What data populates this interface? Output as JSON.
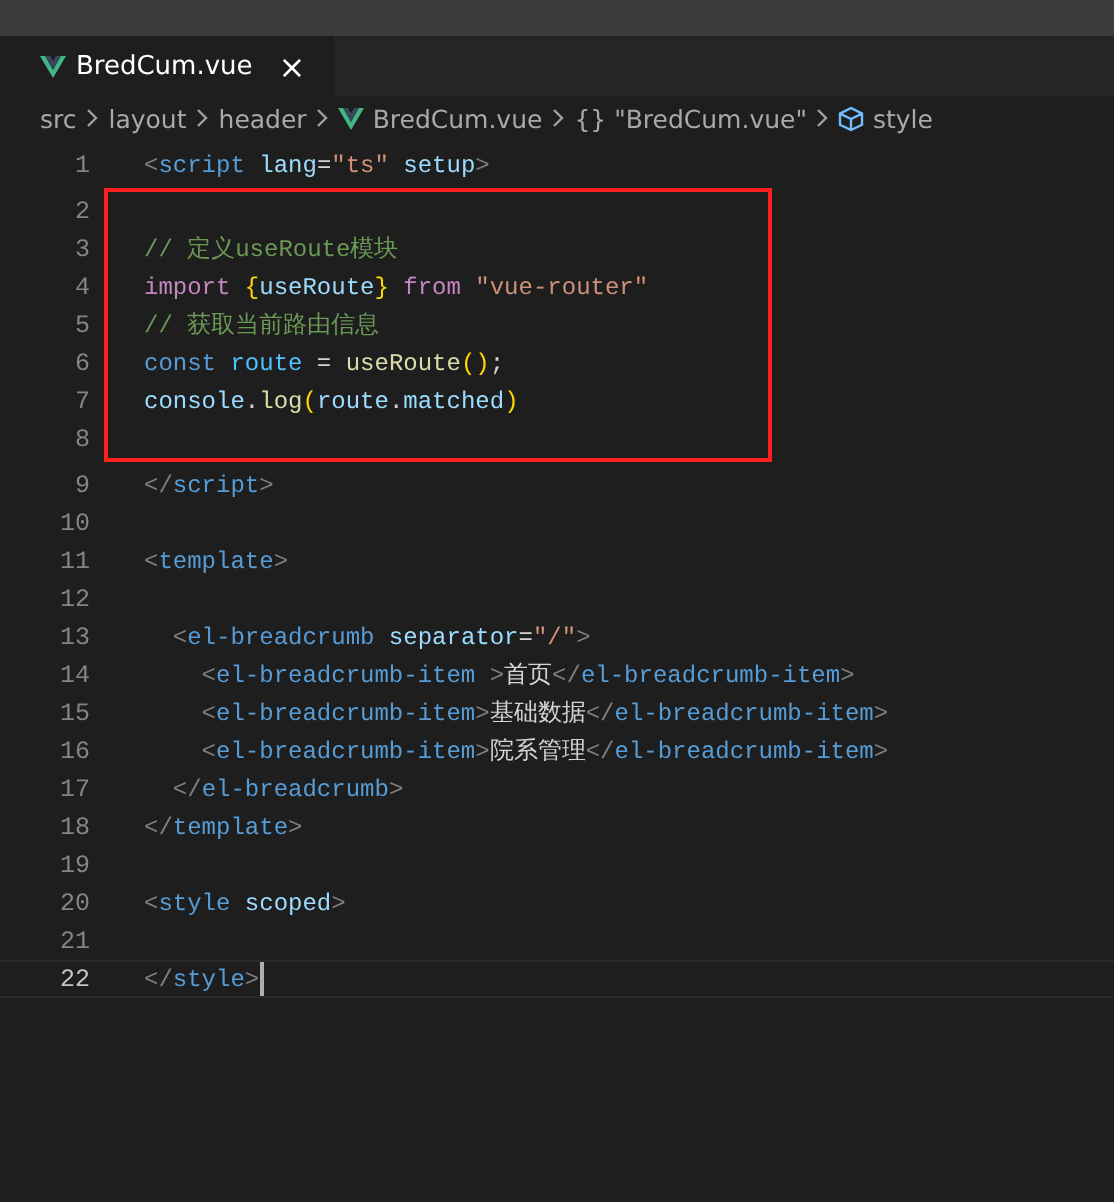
{
  "tabs": [
    {
      "label": "BredCum.vue",
      "close": "×",
      "selected": true
    }
  ],
  "breadcrumb": [
    {
      "label": "src",
      "kind": "folder"
    },
    {
      "label": "layout",
      "kind": "folder"
    },
    {
      "label": "header",
      "kind": "folder"
    },
    {
      "label": "BredCum.vue",
      "kind": "file"
    },
    {
      "label": "{} \"BredCum.vue\"",
      "kind": "object"
    },
    {
      "label": "style",
      "kind": "element"
    }
  ],
  "blocks": [
    {
      "kind": "plain",
      "lines": [
        {
          "number": "1",
          "current": false,
          "tokens": [
            {
              "text": "<",
              "kind": "punct"
            },
            {
              "text": "script",
              "kind": "tag"
            },
            {
              "text": " lang",
              "kind": "attr"
            },
            {
              "text": "=",
              "kind": "plain"
            },
            {
              "text": "\"ts\"",
              "kind": "string"
            },
            {
              "text": " setup",
              "kind": "attr"
            },
            {
              "text": ">",
              "kind": "punct"
            }
          ]
        }
      ]
    },
    {
      "kind": "boxed",
      "lines": [
        {
          "number": "2",
          "current": false
        },
        {
          "number": "3",
          "current": false,
          "tokens": [
            {
              "text": "// 定义useRoute模块",
              "kind": "comment"
            }
          ]
        },
        {
          "number": "4",
          "current": false,
          "tokens": [
            {
              "text": "import",
              "kind": "keyword"
            },
            {
              "text": " {",
              "kind": "bracket"
            },
            {
              "text": "useRoute",
              "kind": "var"
            },
            {
              "text": "}",
              "kind": "bracket"
            },
            {
              "text": " from",
              "kind": "keyword"
            },
            {
              "text": " \"vue-router\"",
              "kind": "string"
            }
          ]
        },
        {
          "number": "5",
          "current": false,
          "tokens": [
            {
              "text": "// 获取当前路由信息",
              "kind": "comment"
            }
          ]
        },
        {
          "number": "6",
          "current": false,
          "tokens": [
            {
              "text": "const",
              "kind": "storage"
            },
            {
              "text": " route",
              "kind": "constant"
            },
            {
              "text": " = ",
              "kind": "plain"
            },
            {
              "text": "useRoute",
              "kind": "func"
            },
            {
              "text": "()",
              "kind": "bracket"
            },
            {
              "text": ";",
              "kind": "plain"
            }
          ]
        },
        {
          "number": "7",
          "current": false,
          "tokens": [
            {
              "text": "console",
              "kind": "var"
            },
            {
              "text": ".",
              "kind": "plain"
            },
            {
              "text": "log",
              "kind": "func"
            },
            {
              "text": "(",
              "kind": "bracket"
            },
            {
              "text": "route",
              "kind": "var"
            },
            {
              "text": ".",
              "kind": "plain"
            },
            {
              "text": "matched",
              "kind": "var"
            },
            {
              "text": ")",
              "kind": "bracket"
            }
          ]
        },
        {
          "number": "8",
          "current": false
        }
      ]
    },
    {
      "kind": "plain",
      "lines": [
        {
          "number": "9",
          "current": false,
          "tokens": [
            {
              "text": "</",
              "kind": "punct"
            },
            {
              "text": "script",
              "kind": "tag"
            },
            {
              "text": ">",
              "kind": "punct"
            }
          ]
        },
        {
          "number": "10",
          "current": false
        },
        {
          "number": "11",
          "current": false,
          "tokens": [
            {
              "text": "<",
              "kind": "punct"
            },
            {
              "text": "template",
              "kind": "tag"
            },
            {
              "text": ">",
              "kind": "punct"
            }
          ]
        },
        {
          "number": "12",
          "current": false
        },
        {
          "number": "13",
          "current": false,
          "tokens": [
            {
              "text": "  <",
              "kind": "punct"
            },
            {
              "text": "el-breadcrumb",
              "kind": "tag"
            },
            {
              "text": " separator",
              "kind": "attr"
            },
            {
              "text": "=",
              "kind": "plain"
            },
            {
              "text": "\"/\"",
              "kind": "string"
            },
            {
              "text": ">",
              "kind": "punct"
            }
          ]
        },
        {
          "number": "14",
          "current": false,
          "tokens": [
            {
              "text": "    <",
              "kind": "punct"
            },
            {
              "text": "el-breadcrumb-item",
              "kind": "tag"
            },
            {
              "text": " >",
              "kind": "punct"
            },
            {
              "text": "首页",
              "kind": "plain"
            },
            {
              "text": "</",
              "kind": "punct"
            },
            {
              "text": "el-breadcrumb-item",
              "kind": "tag"
            },
            {
              "text": ">",
              "kind": "punct"
            }
          ]
        },
        {
          "number": "15",
          "current": false,
          "tokens": [
            {
              "text": "    <",
              "kind": "punct"
            },
            {
              "text": "el-breadcrumb-item",
              "kind": "tag"
            },
            {
              "text": ">",
              "kind": "punct"
            },
            {
              "text": "基础数据",
              "kind": "plain"
            },
            {
              "text": "</",
              "kind": "punct"
            },
            {
              "text": "el-breadcrumb-item",
              "kind": "tag"
            },
            {
              "text": ">",
              "kind": "punct"
            }
          ]
        },
        {
          "number": "16",
          "current": false,
          "tokens": [
            {
              "text": "    <",
              "kind": "punct"
            },
            {
              "text": "el-breadcrumb-item",
              "kind": "tag"
            },
            {
              "text": ">",
              "kind": "punct"
            },
            {
              "text": "院系管理",
              "kind": "plain"
            },
            {
              "text": "</",
              "kind": "punct"
            },
            {
              "text": "el-breadcrumb-item",
              "kind": "tag"
            },
            {
              "text": ">",
              "kind": "punct"
            }
          ]
        },
        {
          "number": "17",
          "current": false,
          "tokens": [
            {
              "text": "  </",
              "kind": "punct"
            },
            {
              "text": "el-breadcrumb",
              "kind": "tag"
            },
            {
              "text": ">",
              "kind": "punct"
            }
          ]
        },
        {
          "number": "18",
          "current": false,
          "tokens": [
            {
              "text": "</",
              "kind": "punct"
            },
            {
              "text": "template",
              "kind": "tag"
            },
            {
              "text": ">",
              "kind": "punct"
            }
          ]
        },
        {
          "number": "19",
          "current": false
        },
        {
          "number": "20",
          "current": false,
          "tokens": [
            {
              "text": "<",
              "kind": "punct"
            },
            {
              "text": "style",
              "kind": "tag"
            },
            {
              "text": " scoped",
              "kind": "attr"
            },
            {
              "text": ">",
              "kind": "punct"
            }
          ]
        },
        {
          "number": "21",
          "current": false
        },
        {
          "number": "22",
          "current": true,
          "tokens": [
            {
              "text": "</",
              "kind": "punct"
            },
            {
              "text": "style",
              "kind": "tag"
            },
            {
              "text": ">",
              "kind": "punct"
            }
          ]
        }
      ]
    }
  ]
}
